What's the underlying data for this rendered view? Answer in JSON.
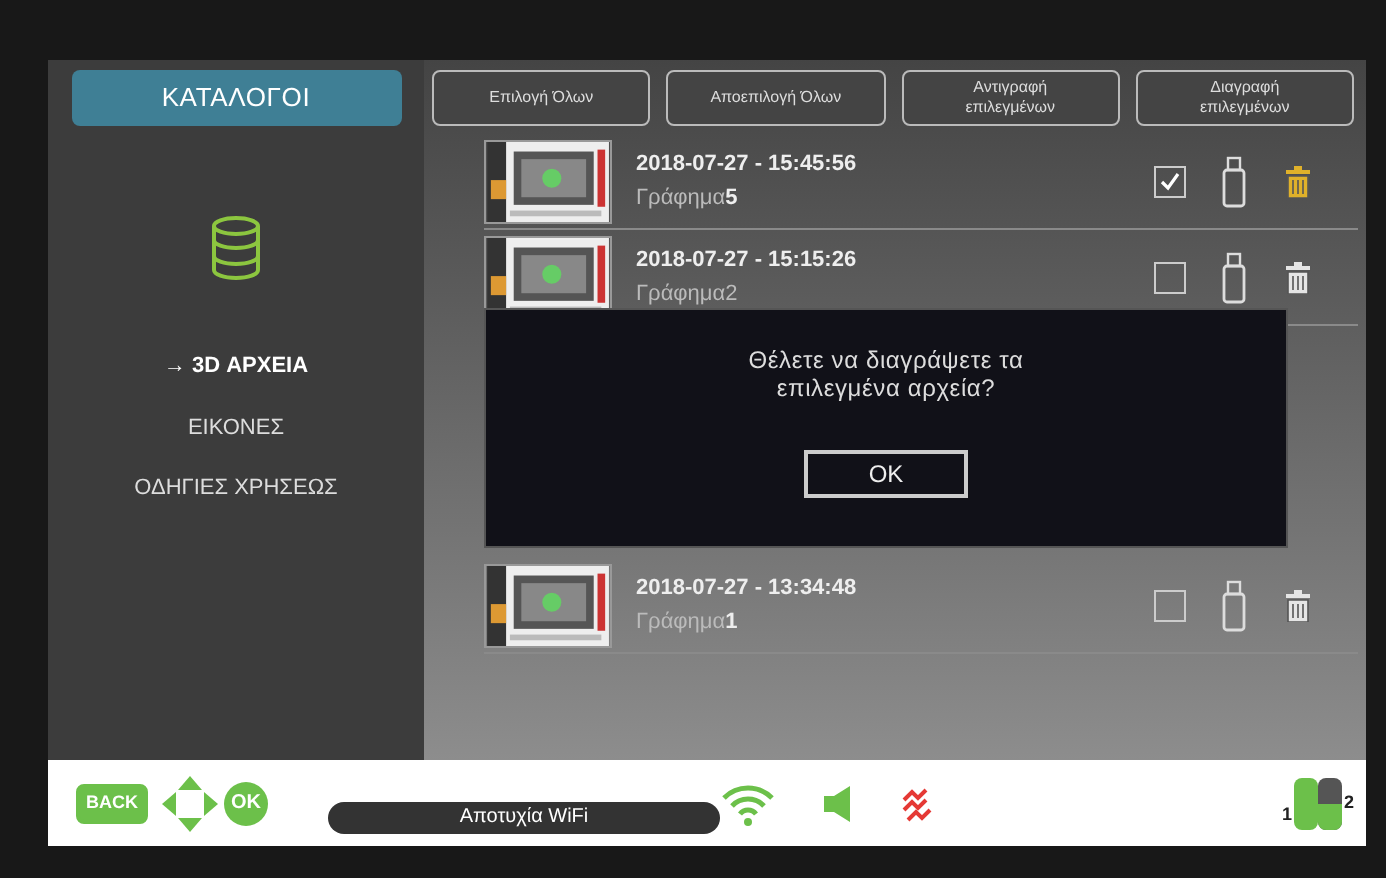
{
  "sidebar": {
    "title": "ΚΑΤΑΛΟΓΟΙ",
    "items": [
      {
        "label": "→ 3D ΑΡΧΕΙΑ",
        "selected": true
      },
      {
        "label": "ΕΙΚΟΝΕΣ",
        "selected": false
      },
      {
        "label": "ΟΔΗΓΙΕΣ ΧΡΗΣΕΩΣ",
        "selected": false
      }
    ]
  },
  "toolbar": [
    "Επιλογή Όλων",
    "Αποεπιλογή Όλων",
    "Αντιγραφή επιλεγμένων",
    "Διαγραφή επιλεγμένων"
  ],
  "files": [
    {
      "date": "2018-07-27 - 15:45:56",
      "name": "Γράφημα",
      "number": "5",
      "checked": true
    },
    {
      "date": "2018-07-27 - 15:15:26",
      "name": "Γράφημα2",
      "checked": false
    },
    {
      "date": "2018-07-27 - 13:34:48",
      "name": "Γράφημα",
      "number": "1",
      "checked": false
    }
  ],
  "dialog": {
    "message": "Θέλετε να διαγράψετε τα επιλεγμένα αρχεία?",
    "button": "OK"
  },
  "status_bar": {
    "back": "BACK",
    "ok": "OK",
    "wifi_status": "Αποτυχία WiFi",
    "batteries": [
      {
        "label": "1",
        "level": 1
      },
      {
        "label": "2",
        "level": 0.5
      }
    ]
  }
}
